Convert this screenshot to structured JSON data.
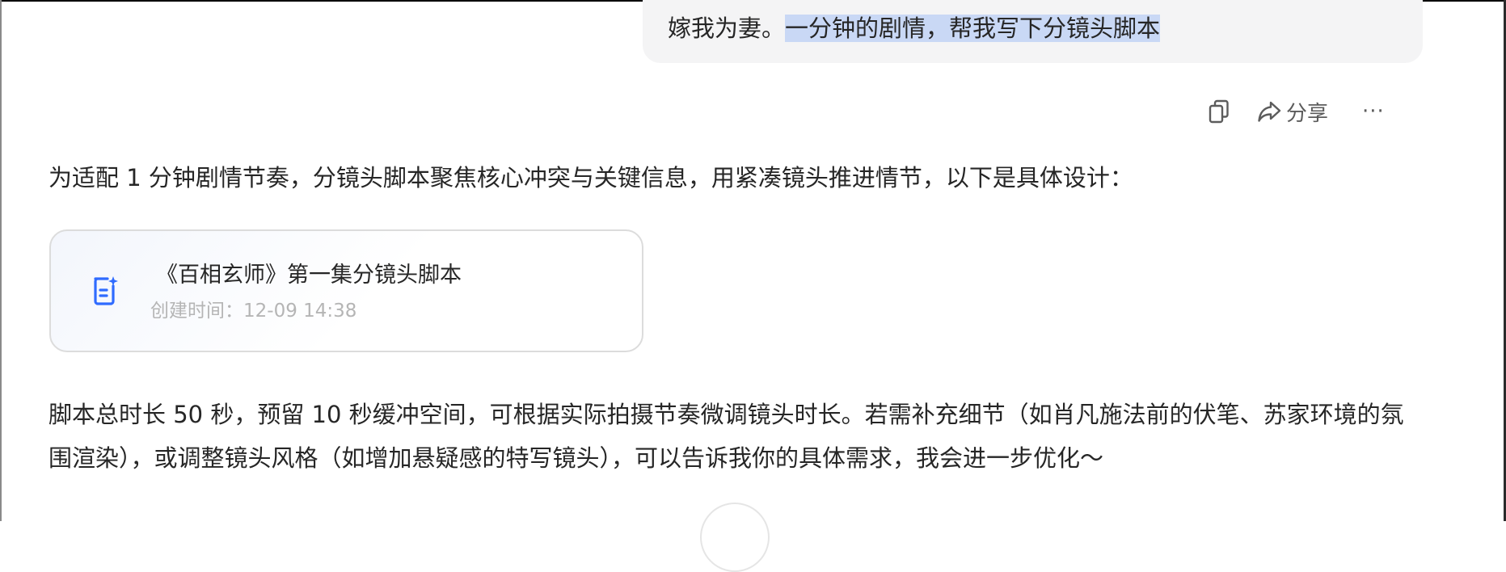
{
  "user_message": {
    "text_before": "嫁我为妻。",
    "text_selected": "一分钟的剧情，帮我写下分镜头脚本"
  },
  "actions": {
    "copy_icon": "copy-icon",
    "share_icon": "share-icon",
    "share_label": "分享",
    "more_label": "···"
  },
  "reply": {
    "intro": "为适配 1 分钟剧情节奏，分镜头脚本聚焦核心冲突与关键信息，用紧凑镜头推进情节，以下是具体设计：",
    "doc_card": {
      "icon": "document-sparkle-icon",
      "title": "《百相玄师》第一集分镜头脚本",
      "meta_label": "创建时间：",
      "meta_time": "12-09 14:38"
    },
    "outro": "脚本总时长 50 秒，预留 10 秒缓冲空间，可根据实际拍摄节奏微调镜头时长。若需补充细节（如肖凡施法前的伏笔、苏家环境的氛围渲染），或调整镜头风格（如增加悬疑感的特写镜头），可以告诉我你的具体需求，我会进一步优化～"
  },
  "colors": {
    "accent_blue": "#2f6bff",
    "selection": "#c9d8f5",
    "bubble_bg": "#f4f4f5"
  }
}
